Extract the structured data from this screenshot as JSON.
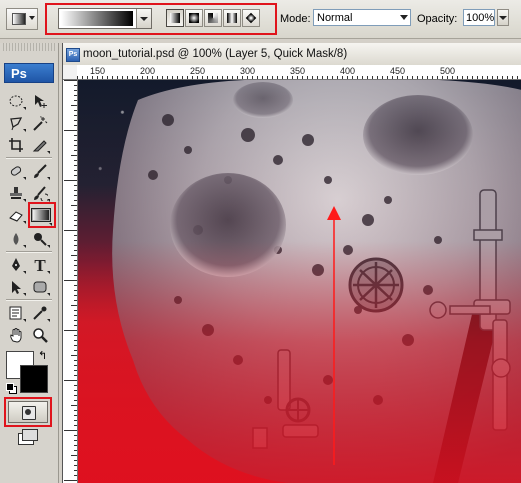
{
  "options_bar": {
    "mode_label": "Mode:",
    "mode_value": "Normal",
    "opacity_label": "Opacity:",
    "opacity_value": "100%",
    "gradient_types": [
      "linear-gradient-icon",
      "radial-gradient-icon",
      "angle-gradient-icon",
      "reflected-gradient-icon",
      "diamond-gradient-icon"
    ],
    "active_gradient_type": "linear-gradient-icon"
  },
  "toolbox": {
    "logo": "Ps"
  },
  "document": {
    "title": "moon_tutorial.psd @ 100% (Layer 5, Quick Mask/8)",
    "ruler_labels": [
      "150",
      "200",
      "250",
      "300",
      "350",
      "400",
      "450",
      "500"
    ]
  },
  "colors": {
    "highlight": "#e0141c",
    "foreground": "#ffffff",
    "background": "#000000"
  }
}
